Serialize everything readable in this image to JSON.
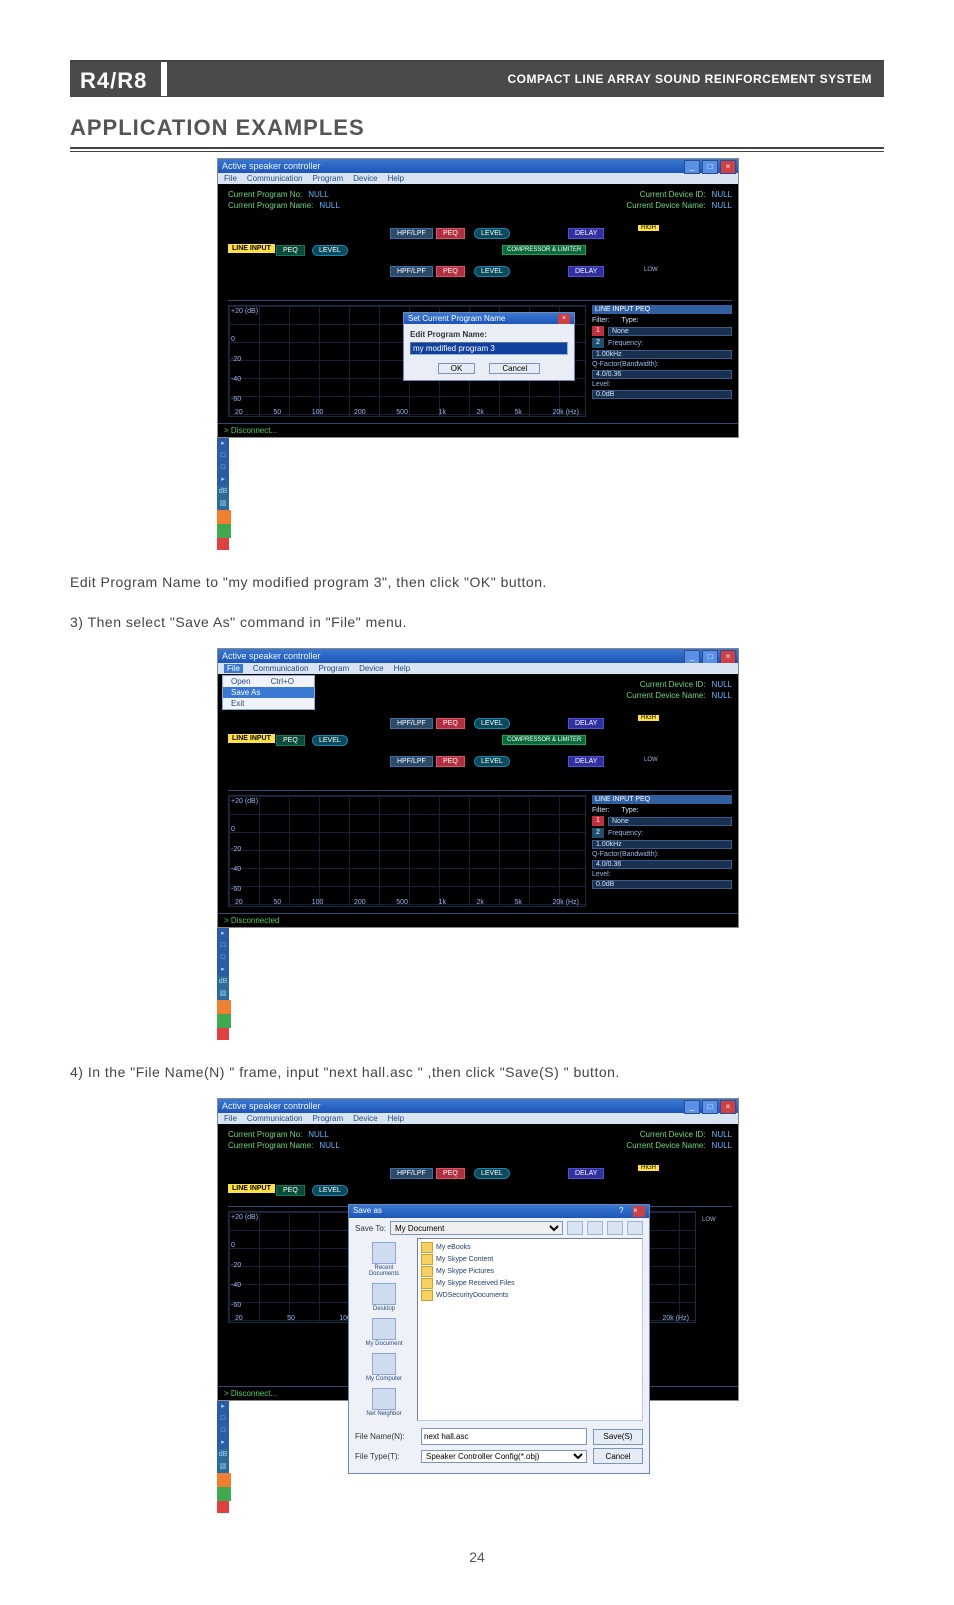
{
  "pageNumber": "24",
  "header": {
    "model": "R4/R8",
    "subtitle": "COMPACT LINE ARRAY SOUND REINFORCEMENT SYSTEM"
  },
  "sectionTitle": "APPLICATION EXAMPLES",
  "captions": {
    "c1": "Edit Program Name to \"my modified program 3\", then click \"OK\" button.",
    "c2": "3) Then select \"Save As\" command in \"File\" menu.",
    "c3": "4) In the  \"File Name(N) \" frame, input  \"next hall.asc \" ,then click  \"Save(S) \" button."
  },
  "appWindow": {
    "title": "Active speaker controller",
    "menus": [
      "File",
      "Communication",
      "Program",
      "Device",
      "Help"
    ]
  },
  "info": {
    "curProgNoLabel": "Current Program No:",
    "curProgNoVal": "NULL",
    "curProgNameLabel": "Current Program Name:",
    "curProgNameVal": "NULL",
    "curDevIdLabel": "Current Device ID:",
    "curDevIdVal": "NULL",
    "curDevNameLabel": "Current Device Name:",
    "curDevNameVal": "NULL"
  },
  "chain": {
    "lineInput": "LINE INPUT",
    "peq": "PEQ",
    "level": "LEVEL",
    "hpf": "HPF/LPF",
    "delay": "DELAY",
    "comp": "COMPRESSOR & LIMITER",
    "high": "HIGH",
    "low": "LOW"
  },
  "graph": {
    "y": [
      "+20 (dB)",
      "0",
      "-20",
      "-40",
      "-60"
    ],
    "x": [
      "20",
      "50",
      "100",
      "200",
      "500",
      "1k",
      "2k",
      "5k",
      "20k (Hz)"
    ]
  },
  "sidePanel": {
    "title": "LINE INPUT PEQ",
    "filterLabel": "Filter:",
    "typeLabel": "Type:",
    "typeVal": "None",
    "f1": "1",
    "f2": "2",
    "freqLabel": "Frequency:",
    "freqVal": "1.00kHz",
    "qLabel": "Q-Factor(Bandwidth):",
    "qVal": "4.0/0.36",
    "levLabel": "Level:",
    "levVal": "0.0dB"
  },
  "editDlg": {
    "titlebar": "Set Current Program Name",
    "label": "Edit Program Name:",
    "value": "my modified program 3",
    "ok": "OK",
    "cancel": "Cancel"
  },
  "fileMenu": {
    "open": "Open",
    "openShort": "Ctrl+O",
    "saveAs": "Save As",
    "exit": "Exit"
  },
  "saveAs": {
    "title": "Save as",
    "saveToLabel": "Save To:",
    "saveToVal": "My Document",
    "places": [
      "Recent Documents",
      "Desktop",
      "My Document",
      "My Computer",
      "Net Neighbor"
    ],
    "folders": [
      "My eBooks",
      "My Skype Content",
      "My Skype Pictures",
      "My Skype Received Files",
      "WDSecurityDocuments"
    ],
    "fileNameLabel": "File Name(N):",
    "fileNameVal": "next hall.asc",
    "fileTypeLabel": "File Type(T):",
    "fileTypeVal": "Speaker Controller Config(*.obj)",
    "saveBtn": "Save(S)",
    "cancelBtn": "Cancel"
  },
  "status": {
    "disconnected": "> Disconnected",
    "disconnect": "> Disconnect..."
  }
}
